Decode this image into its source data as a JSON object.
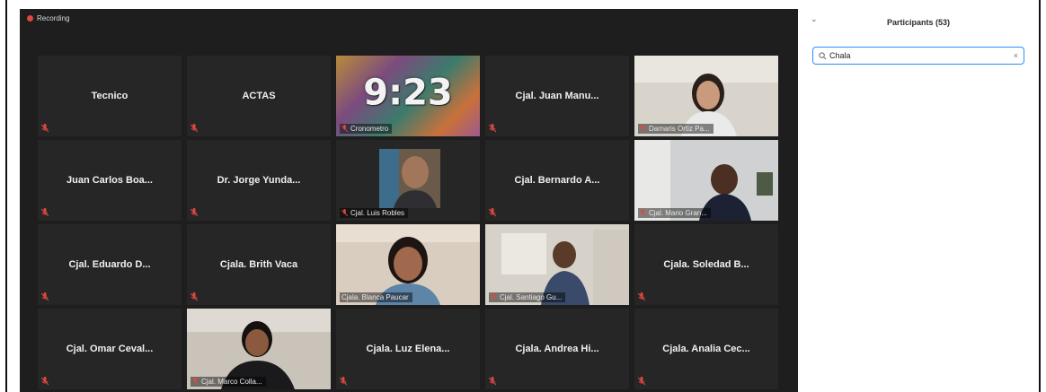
{
  "recording": {
    "label": "Recording"
  },
  "timer": {
    "value": "9:23"
  },
  "tiles": [
    {
      "name": "Tecnico",
      "type": "name"
    },
    {
      "name": "ACTAS",
      "type": "name"
    },
    {
      "name": "Cronometro",
      "type": "timer"
    },
    {
      "name": "Cjal. Juan Manu...",
      "type": "name"
    },
    {
      "name": "Damaris Ortiz Pa...",
      "type": "video"
    },
    {
      "name": "Juan Carlos Boa...",
      "type": "name"
    },
    {
      "name": "Dr. Jorge Yunda...",
      "type": "name"
    },
    {
      "name": "Cjal. Luis Robles",
      "type": "photo"
    },
    {
      "name": "Cjal. Bernardo A...",
      "type": "name"
    },
    {
      "name": "Cjal. Mario Gran...",
      "type": "video"
    },
    {
      "name": "Cjal. Eduardo D...",
      "type": "name"
    },
    {
      "name": "Cjala. Brith Vaca",
      "type": "name"
    },
    {
      "name": "Cjala. Blanca Paucar",
      "type": "video",
      "active": true
    },
    {
      "name": "Cjal. Santiago Gu...",
      "type": "video"
    },
    {
      "name": "Cjala. Soledad B...",
      "type": "name"
    },
    {
      "name": "Cjal. Omar Ceval...",
      "type": "name"
    },
    {
      "name": "Cjal. Marco Colla...",
      "type": "video"
    },
    {
      "name": "Cjala. Luz Elena...",
      "type": "name"
    },
    {
      "name": "Cjala. Andrea Hi...",
      "type": "name"
    },
    {
      "name": "Cjala. Analia Cec...",
      "type": "name"
    }
  ],
  "participants_panel": {
    "title": "Participants (53)",
    "search_value": "Chala",
    "collapse_icon": "chevron-down-icon",
    "clear_icon": "close-icon"
  },
  "colors": {
    "active_speaker": "#c6e24b",
    "muted": "#e0483f",
    "search_focus": "#2d8cff"
  }
}
